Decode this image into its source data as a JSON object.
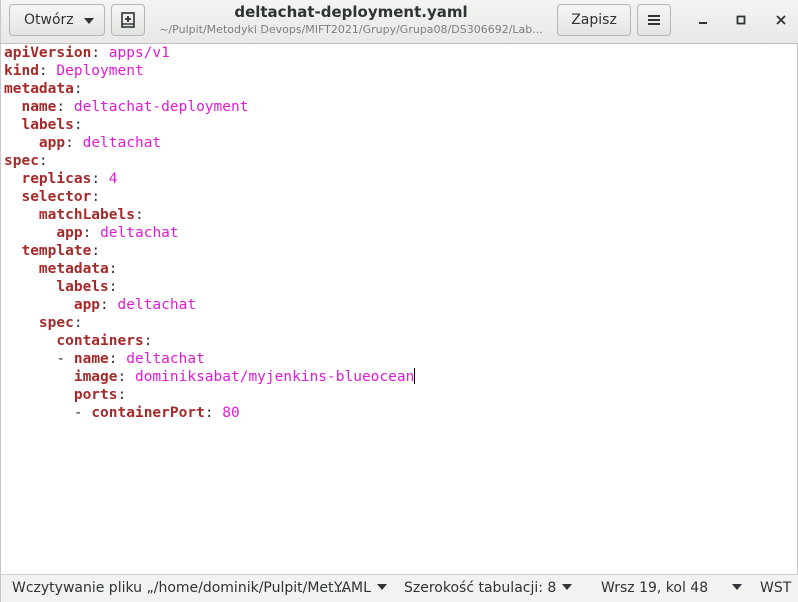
{
  "header": {
    "open_label": "Otwórz",
    "save_label": "Zapisz",
    "title": "deltachat-deployment.yaml",
    "path": "~/Pulpit/Metodyki Devops/MIFT2021/Grupy/Grupa08/DS306692/Lab..."
  },
  "editor": {
    "lines": [
      {
        "indent": "",
        "dash": "",
        "key": "apiVersion",
        "value": "apps/v1"
      },
      {
        "indent": "",
        "dash": "",
        "key": "kind",
        "value": "Deployment"
      },
      {
        "indent": "",
        "dash": "",
        "key": "metadata",
        "value": ""
      },
      {
        "indent": "  ",
        "dash": "",
        "key": "name",
        "value": "deltachat-deployment"
      },
      {
        "indent": "  ",
        "dash": "",
        "key": "labels",
        "value": ""
      },
      {
        "indent": "    ",
        "dash": "",
        "key": "app",
        "value": "deltachat"
      },
      {
        "indent": "",
        "dash": "",
        "key": "spec",
        "value": ""
      },
      {
        "indent": "  ",
        "dash": "",
        "key": "replicas",
        "value": "4"
      },
      {
        "indent": "  ",
        "dash": "",
        "key": "selector",
        "value": ""
      },
      {
        "indent": "    ",
        "dash": "",
        "key": "matchLabels",
        "value": ""
      },
      {
        "indent": "      ",
        "dash": "",
        "key": "app",
        "value": "deltachat"
      },
      {
        "indent": "  ",
        "dash": "",
        "key": "template",
        "value": ""
      },
      {
        "indent": "    ",
        "dash": "",
        "key": "metadata",
        "value": ""
      },
      {
        "indent": "      ",
        "dash": "",
        "key": "labels",
        "value": ""
      },
      {
        "indent": "        ",
        "dash": "",
        "key": "app",
        "value": "deltachat"
      },
      {
        "indent": "    ",
        "dash": "",
        "key": "spec",
        "value": ""
      },
      {
        "indent": "      ",
        "dash": "",
        "key": "containers",
        "value": ""
      },
      {
        "indent": "      ",
        "dash": "- ",
        "key": "name",
        "value": "deltachat"
      },
      {
        "indent": "        ",
        "dash": "",
        "key": "image",
        "value": "dominiksabat/myjenkins-blueocean",
        "cursor": true
      },
      {
        "indent": "        ",
        "dash": "",
        "key": "ports",
        "value": ""
      },
      {
        "indent": "        ",
        "dash": "- ",
        "key": "containerPort",
        "value": "80"
      }
    ]
  },
  "status": {
    "loading_text": "Wczytywanie pliku „/home/dominik/Pulpit/Met...",
    "language": "YAML",
    "tab_width": "Szerokość tabulacji: 8",
    "position": "Wrsz 19, kol 48",
    "insert_mode": "WST"
  },
  "colors": {
    "key": "#a52a2a",
    "value": "#e01bd6"
  }
}
